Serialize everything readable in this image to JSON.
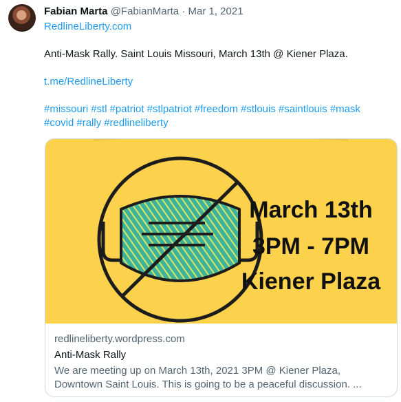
{
  "tweet": {
    "author_name": "Fabian Marta",
    "author_handle": "@FabianMarta",
    "separator": "·",
    "date": "Mar 1, 2021",
    "site_link": "RedlineLiberty.com",
    "text_line": "Anti-Mask Rally.  Saint Louis Missouri, March 13th @ Kiener Plaza.",
    "telegram_link": "t.me/RedlineLiberty",
    "hashtags": [
      "#missouri",
      "#stl",
      "#patriot",
      "#stlpatriot",
      "#freedom",
      "#stlouis",
      "#saintlouis",
      "#mask",
      "#covid",
      "#rally",
      "#redlineliberty"
    ]
  },
  "card": {
    "image": {
      "line1": "March 13th",
      "line2": "3PM - 7PM",
      "line3": "Kiener Plaza",
      "background_color": "#fcd24c",
      "mask_color": "#3fb29a",
      "icon": "no-mask-icon"
    },
    "domain": "redlineliberty.wordpress.com",
    "title": "Anti-Mask Rally",
    "description_line1": "We are meeting up on March 13th, 2021 3PM @ Kiener Plaza,",
    "description_line2": "Downtown Saint Louis. This is going to be a peaceful discussion. ..."
  },
  "colors": {
    "link": "#1d9bf0",
    "secondary_text": "#536471",
    "border": "#cfd9de"
  }
}
